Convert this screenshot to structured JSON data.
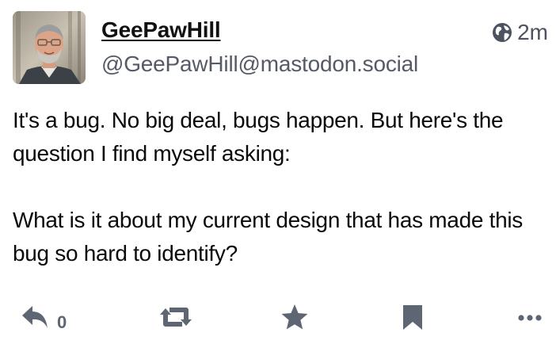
{
  "author": {
    "display_name": "GeePawHill",
    "handle": "@GeePawHill@mastodon.social"
  },
  "meta": {
    "visibility_icon": "globe-icon",
    "timestamp": "2m"
  },
  "content": {
    "paragraphs": [
      "It's a bug. No big deal, bugs happen. But here's the question I find myself asking:",
      "What is it about my current design that has made this bug so hard to identify?"
    ]
  },
  "actions": {
    "reply_icon": "reply-icon",
    "reply_count": "0",
    "boost_icon": "boost-icon",
    "favourite_icon": "star-icon",
    "bookmark_icon": "bookmark-icon",
    "more_icon": "more-icon"
  },
  "colors": {
    "text": "#0a0a0a",
    "secondary_text": "#555a66",
    "icon_gray": "#5f6673"
  }
}
